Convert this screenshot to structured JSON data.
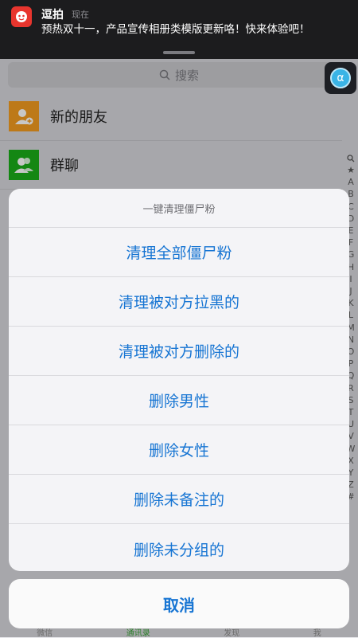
{
  "notification": {
    "app": "逗拍",
    "time": "现在",
    "message": "预热双十一，产品宣传相册类模版更新咯！快来体验吧！"
  },
  "search": {
    "placeholder": "搜索"
  },
  "float_button": {
    "glyph": "α"
  },
  "contacts": [
    {
      "label": "新的朋友",
      "icon": "add-friend-icon",
      "color": "#f39c1f"
    },
    {
      "label": "群聊",
      "icon": "group-chat-icon",
      "color": "#1aad19"
    }
  ],
  "index_letters": [
    "★",
    "A",
    "B",
    "C",
    "D",
    "E",
    "F",
    "G",
    "H",
    "I",
    "J",
    "K",
    "L",
    "M",
    "N",
    "O",
    "P",
    "Q",
    "R",
    "S",
    "T",
    "U",
    "V",
    "W",
    "X",
    "Y",
    "Z",
    "#"
  ],
  "action_sheet": {
    "title": "一键清理僵尸粉",
    "items": [
      "清理全部僵尸粉",
      "清理被对方拉黑的",
      "清理被对方删除的",
      "删除男性",
      "删除女性",
      "删除未备注的",
      "删除未分组的"
    ],
    "cancel": "取消",
    "accent_color": "#1775d3"
  },
  "tabbar": [
    "微信",
    "通讯录",
    "发现",
    "我"
  ]
}
